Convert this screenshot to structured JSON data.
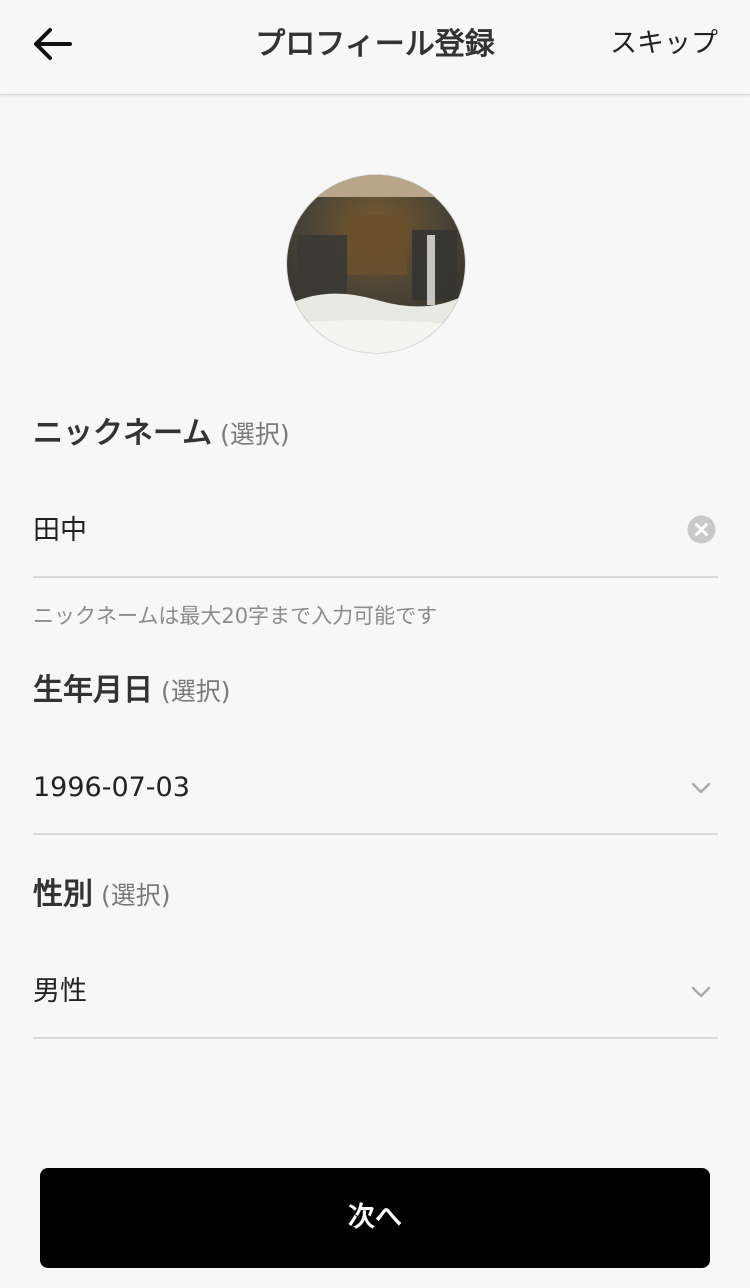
{
  "header": {
    "title": "プロフィール登録",
    "skip_label": "スキップ",
    "back_icon": "arrow-left-icon"
  },
  "avatar": {
    "icon": "profile-photo"
  },
  "nickname": {
    "label": "ニックネーム",
    "optional": "(選択)",
    "value": "田中",
    "helper": "ニックネームは最大20字まで入力可能です",
    "clear_icon": "clear-circle-icon"
  },
  "birthday": {
    "label": "生年月日",
    "optional": "(選択)",
    "value": "1996-07-03",
    "chevron_icon": "chevron-down-icon"
  },
  "gender": {
    "label": "性別",
    "optional": "(選択)",
    "value": "男性",
    "chevron_icon": "chevron-down-icon"
  },
  "footer": {
    "next_label": "次へ"
  },
  "colors": {
    "background": "#f7f7f7",
    "button": "#000000",
    "divider": "#d9d9d9"
  }
}
